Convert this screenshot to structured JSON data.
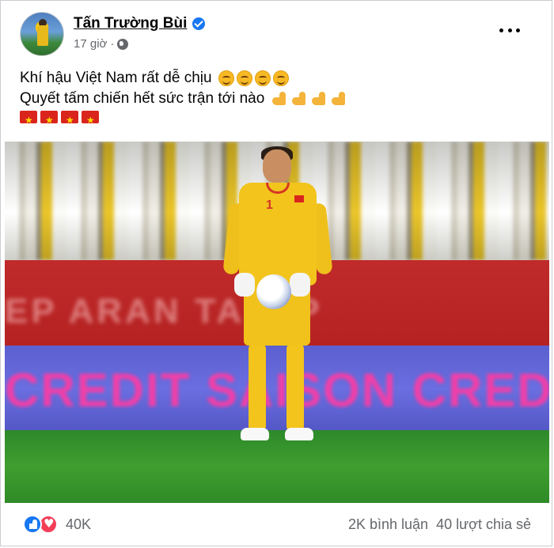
{
  "post": {
    "author": "Tấn Trường Bùi",
    "time": "17 giờ",
    "separator": "·",
    "text_line_1": "Khí hậu Việt Nam rất dễ chịu",
    "text_line_2": "Quyết tấm chiến hết sức trận tới nào",
    "line_1_emoji": "smiling-face-icon",
    "line_2_emoji": "flexed-biceps-icon",
    "line_3_emoji": "vietnam-flag-icon"
  },
  "photo": {
    "red_banner_text": "EP ARAN TA  AIP",
    "led_board_text": "CREDIT SAISON CREDIT SAISON CRE",
    "jersey_number": "1"
  },
  "footer": {
    "reaction_count": "40K",
    "comments": "2K bình luận",
    "shares": "40 lượt chia sẻ"
  },
  "colors": {
    "accent_blue": "#1877f2",
    "love_red": "#f33e58",
    "meta_gray": "#65676b"
  }
}
